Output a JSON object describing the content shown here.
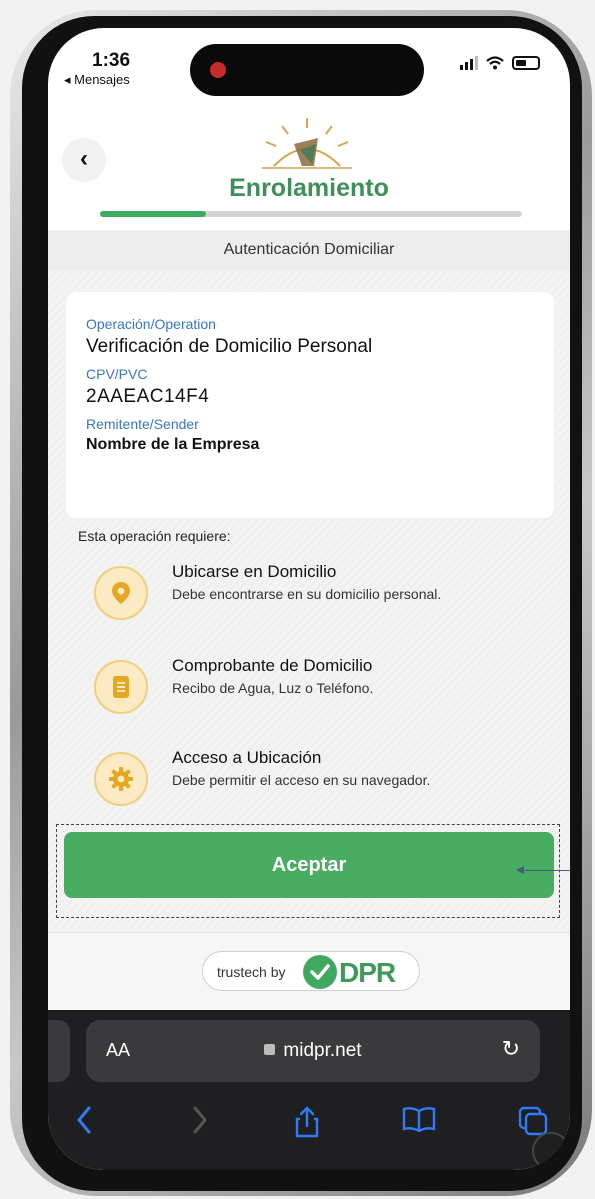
{
  "status": {
    "time": "1:36",
    "back_label": "◂ Mensajes"
  },
  "header": {
    "back_glyph": "‹",
    "title": "Enrolamiento",
    "progress_fraction": 0.25
  },
  "subheader": "Autenticación Domiciliar",
  "info": [
    {
      "label": "Operación/Operation",
      "value": "Verificación de Domicilio Personal"
    },
    {
      "label": "CPV/PVC",
      "value": "2AAEAC14F4"
    },
    {
      "label": "Remitente/Sender",
      "value": "Nombre de la Empresa"
    }
  ],
  "requirements": {
    "title": "Esta operación requiere:",
    "items": [
      {
        "icon": "location-pin-icon",
        "title": "Ubicarse en Domicilio",
        "desc": "Debe encontrarse en su domicilio personal."
      },
      {
        "icon": "document-icon",
        "title": "Comprobante de Domicilio",
        "desc": "Recibo de Agua, Luz o Teléfono."
      },
      {
        "icon": "gear-icon",
        "title": "Acceso a Ubicación",
        "desc": "Debe permitir el acceso en su navegador."
      }
    ]
  },
  "accept_label": "Aceptar",
  "footer": {
    "prefix": "trustech by",
    "brand": "DPR"
  },
  "browser": {
    "aa": "AA",
    "url": "midpr.net",
    "reload_glyph": "↻"
  },
  "colors": {
    "accent_green": "#48ad63",
    "title_green": "#3f8f5a",
    "label_blue": "#3a74c9",
    "icon_bg": "#fbeac3",
    "icon_accent": "#e6a722"
  }
}
